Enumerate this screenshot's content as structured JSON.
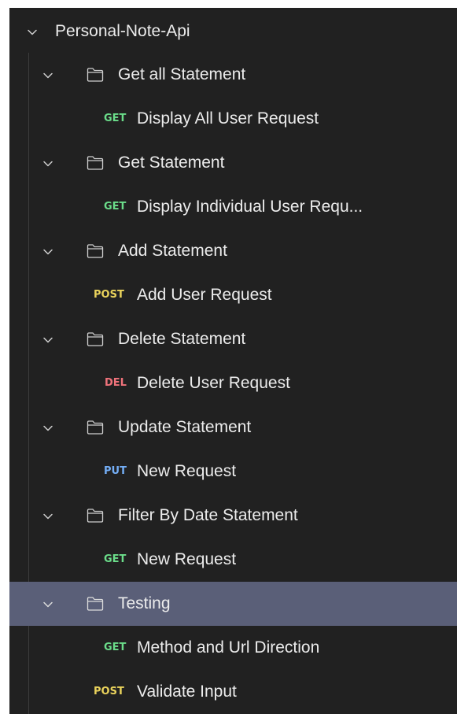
{
  "collection": {
    "name": "Personal-Note-Api"
  },
  "folders": [
    {
      "name": "Get all Statement",
      "request": {
        "method": "GET",
        "name": "Display All User Request"
      }
    },
    {
      "name": "Get Statement",
      "request": {
        "method": "GET",
        "name": "Display Individual User Requ..."
      }
    },
    {
      "name": "Add Statement",
      "request": {
        "method": "POST",
        "name": "Add User Request"
      }
    },
    {
      "name": "Delete Statement",
      "request": {
        "method": "DEL",
        "name": "Delete User Request"
      }
    },
    {
      "name": "Update Statement",
      "request": {
        "method": "PUT",
        "name": "New Request"
      }
    },
    {
      "name": "Filter By Date Statement",
      "request": {
        "method": "GET",
        "name": "New Request"
      }
    },
    {
      "name": "Testing",
      "request": {
        "method": "GET",
        "name": "Method and Url Direction"
      }
    }
  ],
  "loose_requests": [
    {
      "method": "POST",
      "name": "Validate Input"
    }
  ],
  "selected_folder": "Testing",
  "colors": {
    "background": "#212121",
    "selected_row": "#5a5f78",
    "GET": "#6bdd8a",
    "POST": "#ead35c",
    "DEL": "#f0737b",
    "PUT": "#74aef6"
  },
  "icons": {
    "expand": "chevron-down-icon",
    "folder": "folder-icon"
  }
}
